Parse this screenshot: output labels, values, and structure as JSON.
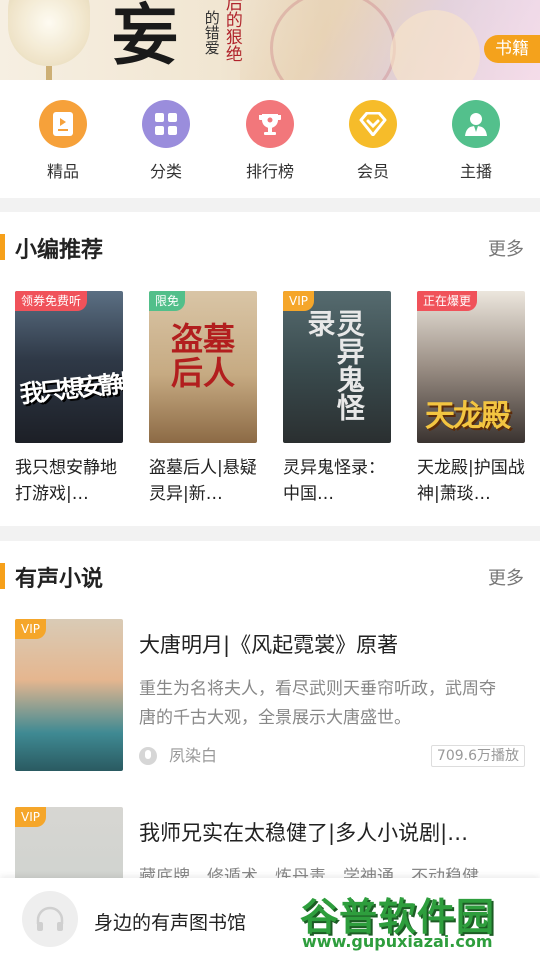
{
  "banner": {
    "calligraphy": "妄",
    "vertical_text_1": "后的狠绝",
    "vertical_text_2": "的错爱",
    "badge": "书籍"
  },
  "categories": [
    {
      "label": "精品",
      "icon": "book-icon",
      "color": "#f6a13a"
    },
    {
      "label": "分类",
      "icon": "grid-icon",
      "color": "#9a8ddc"
    },
    {
      "label": "排行榜",
      "icon": "trophy-icon",
      "color": "#f2777b"
    },
    {
      "label": "会员",
      "icon": "diamond-icon",
      "color": "#f6bc2a"
    },
    {
      "label": "主播",
      "icon": "person-icon",
      "color": "#53c08c"
    }
  ],
  "editor_picks": {
    "title": "小编推荐",
    "more": "更多",
    "books": [
      {
        "tag": "领券免费听",
        "cover_text": "我只想安静地打游戏",
        "title": "我只想安静地打游戏|…"
      },
      {
        "tag": "限免",
        "cover_text": "盗墓后人",
        "title": "盗墓后人|悬疑灵异|新…"
      },
      {
        "tag": "VIP",
        "cover_text": "灵异鬼怪录",
        "title": "灵异鬼怪录：中国…"
      },
      {
        "tag": "正在爆更",
        "cover_text": "天龙殿",
        "title": "天龙殿|护国战神|萧琰…"
      }
    ]
  },
  "audio_novels": {
    "title": "有声小说",
    "more": "更多",
    "items": [
      {
        "tag": "VIP",
        "title": "大唐明月|《风起霓裳》原著",
        "description": "重生为名将夫人，看尽武则天垂帘听政，武周夺唐的千古大观，全景展示大唐盛世。",
        "author": "夙染白",
        "plays": "709.6万播放"
      },
      {
        "tag": "VIP",
        "title": "我师兄实在太稳健了|多人小说剧|…",
        "description": "藏底牌、修遁术、炼丹毒、学神通、不动稳健…"
      }
    ]
  },
  "player": {
    "title": "身边的有声图书馆"
  },
  "watermark": {
    "text": "谷普软件园",
    "url": "www.gupuxiazai.com"
  }
}
